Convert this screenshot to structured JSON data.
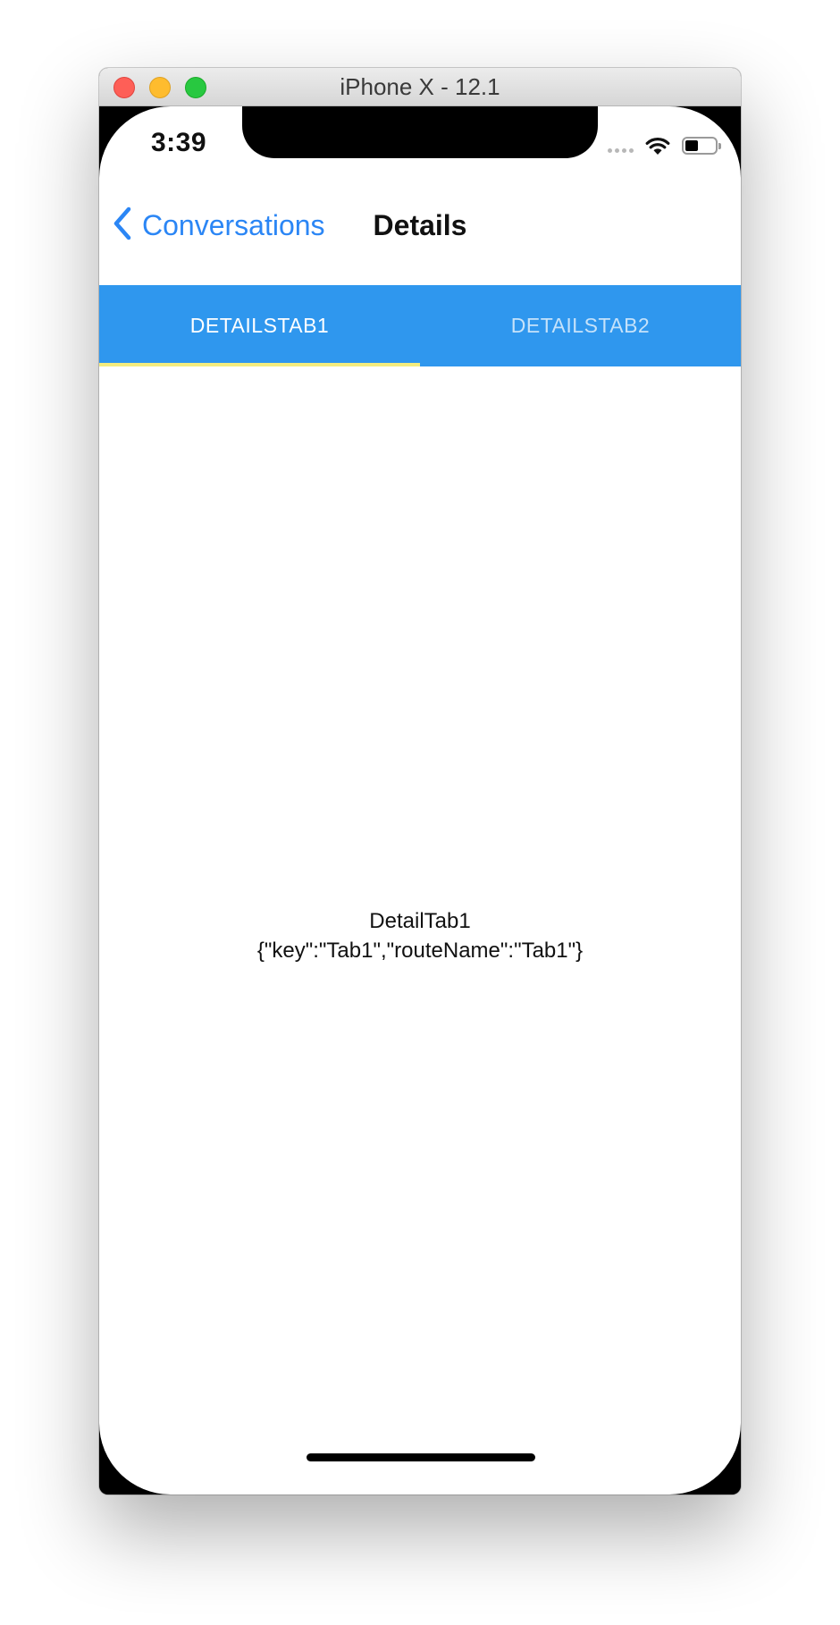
{
  "window": {
    "title": "iPhone X - 12.1"
  },
  "status_bar": {
    "time": "3:39",
    "signal_icon": "signal-dots-icon",
    "wifi_icon": "wifi-icon",
    "battery_icon": "battery-icon"
  },
  "navbar": {
    "back_label": "Conversations",
    "back_icon": "chevron-left-icon",
    "title": "Details"
  },
  "tabs": [
    {
      "label": "DETAILSTAB1",
      "selected": true
    },
    {
      "label": "DETAILSTAB2",
      "selected": false
    }
  ],
  "content": {
    "line1": "DetailTab1",
    "line2": "{\"key\":\"Tab1\",\"routeName\":\"Tab1\"}"
  },
  "colors": {
    "tab_bar": "#2f97ee",
    "tab_indicator": "#f4ec7e",
    "link": "#2b86f5"
  }
}
